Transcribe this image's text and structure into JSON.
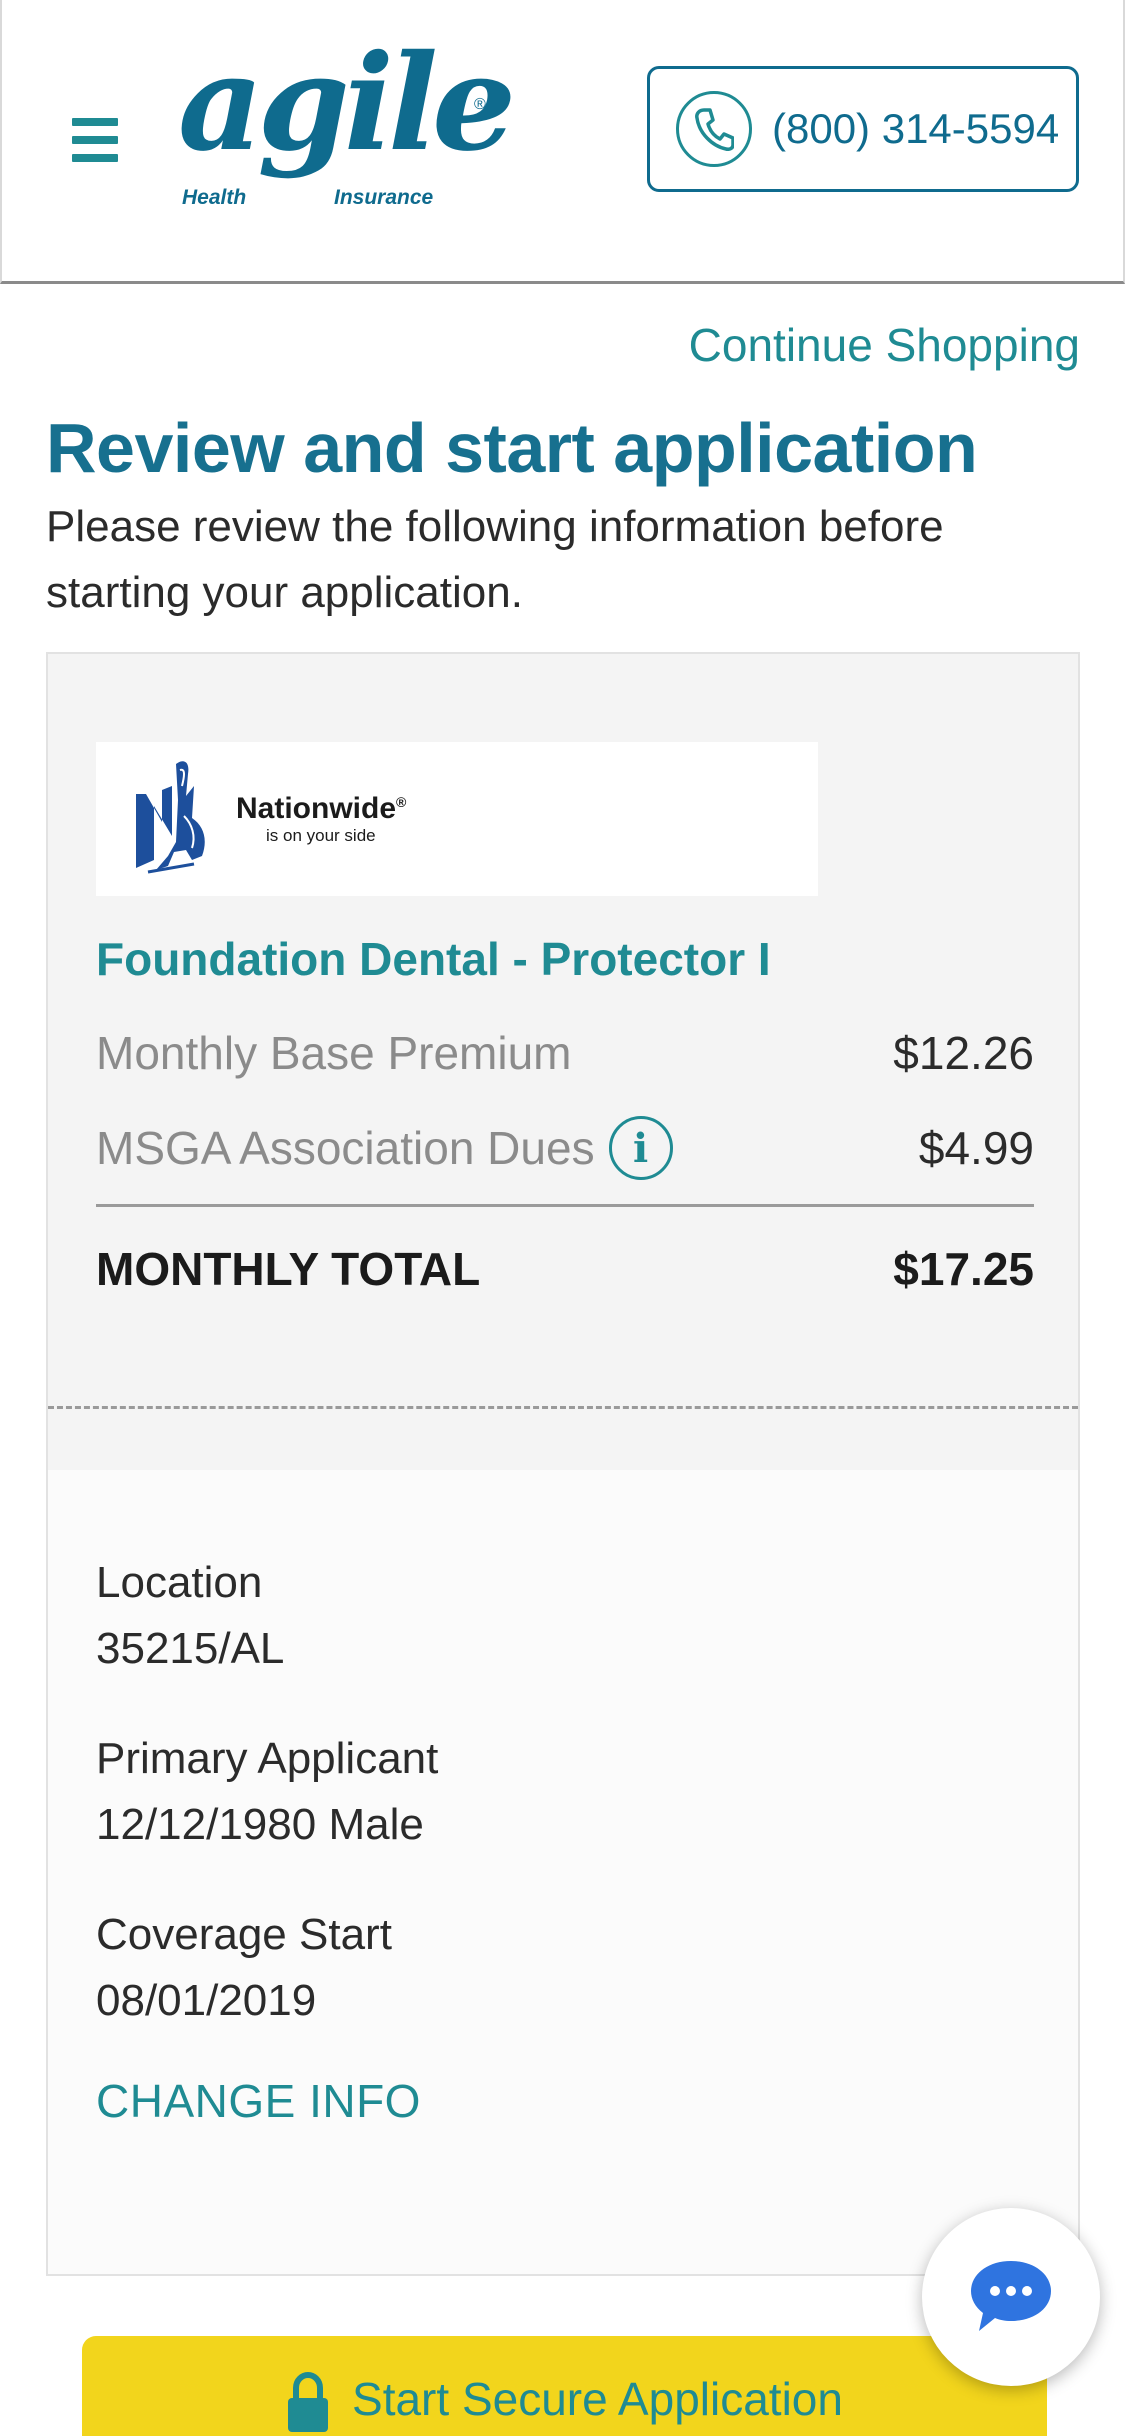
{
  "header": {
    "menu_icon": "hamburger-menu-icon",
    "logo_text": "agile",
    "logo_registered": "®",
    "logo_health": "Health",
    "logo_insurance": "Insurance",
    "phone_icon": "phone-icon",
    "phone_number": "(800) 314-5594"
  },
  "page": {
    "continue_link": "Continue Shopping",
    "title": "Review and start application",
    "subtitle": "Please review the following information before starting your application."
  },
  "plan": {
    "carrier_name": "Nationwide",
    "carrier_registered": "®",
    "carrier_tagline": "is on your side",
    "plan_name": "Foundation Dental - Protector I",
    "base_premium_label": "Monthly Base Premium",
    "base_premium_value": "$12.26",
    "dues_label": "MSGA Association Dues",
    "dues_info_icon": "info-icon",
    "dues_info_glyph": "i",
    "dues_value": "$4.99",
    "total_label": "MONTHLY TOTAL",
    "total_value": "$17.25"
  },
  "details": {
    "location_label": "Location",
    "location_value": "35215/AL",
    "applicant_label": "Primary Applicant",
    "applicant_value": "12/12/1980 Male",
    "coverage_label": "Coverage Start",
    "coverage_value": "08/01/2019",
    "change_info": "CHANGE INFO"
  },
  "cta": {
    "icon": "lock-icon",
    "label": "Start Secure Application"
  },
  "chat": {
    "icon": "chat-bubble-icon"
  },
  "colors": {
    "brand_teal": "#1f8b93",
    "brand_blue": "#0f6b8e",
    "cta_yellow": "#f2d51c"
  }
}
